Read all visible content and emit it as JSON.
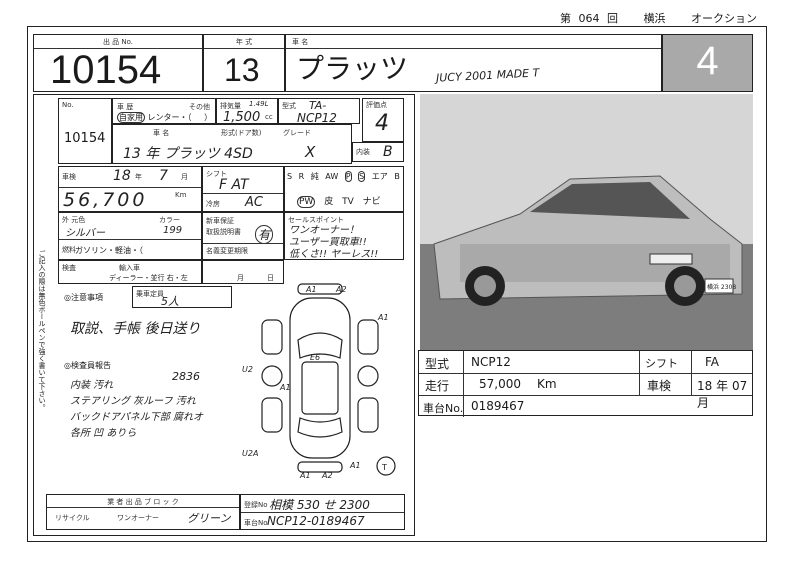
{
  "top_header": {
    "prefix": "第",
    "auction_no": "064",
    "suffix": "回",
    "location": "横浜",
    "auction": "オークション"
  },
  "title_row": {
    "lot_label": "出 品 No.",
    "lot_no": "10154",
    "year_label": "年 式",
    "year": "13",
    "model_label": "車 名",
    "model": "プラッツ",
    "note": "JUCY 2001 MADE T",
    "grade_score": "4"
  },
  "sheet": {
    "no_label": "No.",
    "no_value": "10154",
    "reg_label": "自家用",
    "rent_label": "レンター・（",
    "reg_close": "）",
    "other_label": "その他",
    "displacement_label": "排気量",
    "displacement_value": "1,500",
    "displacement_alt": "1.49L",
    "displacement_unit": "cc",
    "type_label": "型式",
    "type_value": "TA-",
    "type_code": "NCP12",
    "score_label": "評価点",
    "score_value": "4",
    "interior_label": "内装",
    "interior_value": "B",
    "grade_label": "グレード",
    "grade_value": "X",
    "year_model": "13 年 プラッツ 4SD",
    "shaken_label": "車検",
    "shaken_year": "18",
    "shaken_year_unit": "年",
    "shaken_month": "7",
    "shaken_month_unit": "月",
    "mileage_value": "56,700",
    "mileage_unit": "Km",
    "shift_label": "シフト",
    "shift_value": "F AT",
    "ac_label": "冷房",
    "ac_value": "AC",
    "color_label": "カラー",
    "color_value": "シルバー",
    "color_code": "199",
    "fuel_label": "燃料",
    "fuel_value": "ガソリン・軽油・（",
    "options_top": [
      "S",
      "R",
      "純",
      "AW",
      "P",
      "S",
      "エア",
      "B"
    ],
    "options_bottom": [
      "PW",
      "皮",
      "TV",
      "ナビ"
    ],
    "seats_label": "乗車定員",
    "seats_value": "5人",
    "import_label": "輸入車",
    "import_value": "ディーラー・並行 右・左",
    "notes_label": "◎注意事項",
    "notes_text": "取説、手帳 後日送り",
    "warranty_label": "新車保証",
    "warranty_value": "有",
    "manual_label": "取扱説明書",
    "recycle_label": "名義変更期限",
    "recycle_month": "月",
    "recycle_day": "日",
    "sales_label": "セールスポイント",
    "sales_points": [
      "ワンオーナー！",
      "ユーザー買取車!!",
      "低くさ!! ヤーレス!!"
    ],
    "inspection_label": "◎検査員報告",
    "inspection_lines": [
      "内装 汚れ",
      "ステアリング 灰ルーフ 汚れ",
      "バックドアパネル下部 腐れオ",
      "各所 凹 ありら"
    ],
    "inspection_num": "2836",
    "diagram_marks": [
      "A1",
      "A2",
      "A1",
      "A1",
      "A1",
      "A2",
      "A1",
      "E6",
      "U2",
      "U2A"
    ],
    "diagram_circle": "T",
    "block_label": "業 者 出 品 ブ ロ ッ ク",
    "recycle": "リサイクル",
    "one_owner": "ワンオーナー",
    "green": "グリーン",
    "reg_no_label": "登録No",
    "reg_no_value": "相模 530 せ 2300",
    "chassis_label": "車台No",
    "chassis_value": "NCP12-0189467",
    "side_text": "ご記入の際は無色ボールペンで強く書いて下さい。"
  },
  "summary": {
    "type_label": "型式",
    "type_value": "NCP12",
    "shift_label": "シフト",
    "shift_value": "FA",
    "mileage_label": "走行",
    "mileage_value": "57,000",
    "mileage_unit": "Km",
    "shaken_label": "車検",
    "shaken_year": "18",
    "shaken_year_unit": "年",
    "shaken_month": "07",
    "shaken_month_unit": "月",
    "chassis_label": "車台No.",
    "chassis_value": "0189467"
  },
  "photo": {
    "plate": "横浜 2308"
  }
}
